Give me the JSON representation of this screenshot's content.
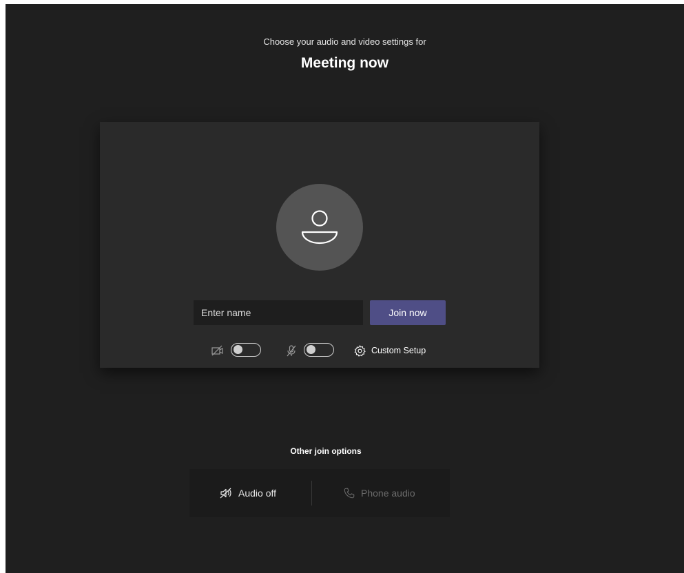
{
  "header": {
    "subtitle": "Choose your audio and video settings for",
    "meeting_title": "Meeting now"
  },
  "preview": {
    "avatar_icon": "person-icon",
    "name_placeholder": "Enter name",
    "name_value": "",
    "join_label": "Join now",
    "camera_icon": "camera-off-icon",
    "camera_toggle_on": false,
    "mic_icon": "mic-off-icon",
    "mic_toggle_on": false,
    "custom_setup_icon": "gear-icon",
    "custom_setup_label": "Custom Setup"
  },
  "other_options": {
    "title": "Other join options",
    "audio_off_icon": "speaker-off-icon",
    "audio_off_label": "Audio off",
    "phone_icon": "phone-icon",
    "phone_label": "Phone audio"
  },
  "colors": {
    "background": "#1f1f1f",
    "card": "#2a2a2a",
    "join_button": "#4f4e86",
    "avatar": "#545454"
  }
}
